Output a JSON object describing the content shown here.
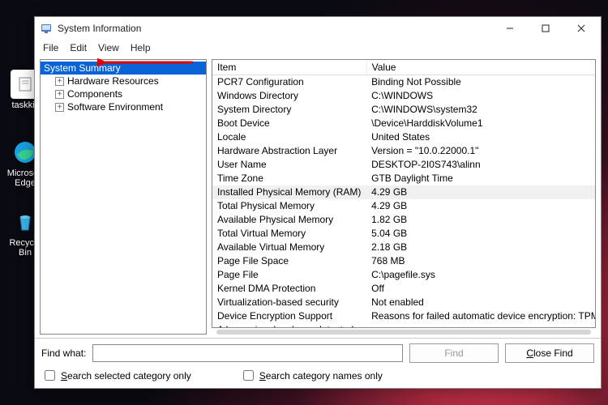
{
  "desktop": {
    "icons": [
      {
        "label": "taskkill",
        "color": "#fafafa"
      },
      {
        "label": "Microsoft Edge",
        "color": "#1a9fde"
      },
      {
        "label": "Recycle Bin",
        "color": "#2aa3e0"
      }
    ]
  },
  "window": {
    "title": "System Information"
  },
  "menu": [
    "File",
    "Edit",
    "View",
    "Help"
  ],
  "tree": {
    "root": "System Summary",
    "children": [
      "Hardware Resources",
      "Components",
      "Software Environment"
    ]
  },
  "columns": [
    "Item",
    "Value"
  ],
  "rows": [
    {
      "item": "PCR7 Configuration",
      "value": "Binding Not Possible"
    },
    {
      "item": "Windows Directory",
      "value": "C:\\WINDOWS"
    },
    {
      "item": "System Directory",
      "value": "C:\\WINDOWS\\system32"
    },
    {
      "item": "Boot Device",
      "value": "\\Device\\HarddiskVolume1"
    },
    {
      "item": "Locale",
      "value": "United States"
    },
    {
      "item": "Hardware Abstraction Layer",
      "value": "Version = \"10.0.22000.1\""
    },
    {
      "item": "User Name",
      "value": "DESKTOP-2I0S743\\alinn"
    },
    {
      "item": "Time Zone",
      "value": "GTB Daylight Time"
    },
    {
      "item": "Installed Physical Memory (RAM)",
      "value": "4.29 GB",
      "hl": true
    },
    {
      "item": "Total Physical Memory",
      "value": "4.29 GB"
    },
    {
      "item": "Available Physical Memory",
      "value": "1.82 GB"
    },
    {
      "item": "Total Virtual Memory",
      "value": "5.04 GB"
    },
    {
      "item": "Available Virtual Memory",
      "value": "2.18 GB"
    },
    {
      "item": "Page File Space",
      "value": "768 MB"
    },
    {
      "item": "Page File",
      "value": "C:\\pagefile.sys"
    },
    {
      "item": "Kernel DMA Protection",
      "value": "Off"
    },
    {
      "item": "Virtualization-based security",
      "value": "Not enabled"
    },
    {
      "item": "Device Encryption Support",
      "value": "Reasons for failed automatic device encryption: TPM is not"
    },
    {
      "item": "A hypervisor has been detected...",
      "value": ""
    }
  ],
  "find": {
    "label": "Find what:",
    "value": "",
    "find_btn": "Find",
    "close_btn": "Close Find",
    "chk1": "Search selected category only",
    "chk2": "Search category names only"
  }
}
